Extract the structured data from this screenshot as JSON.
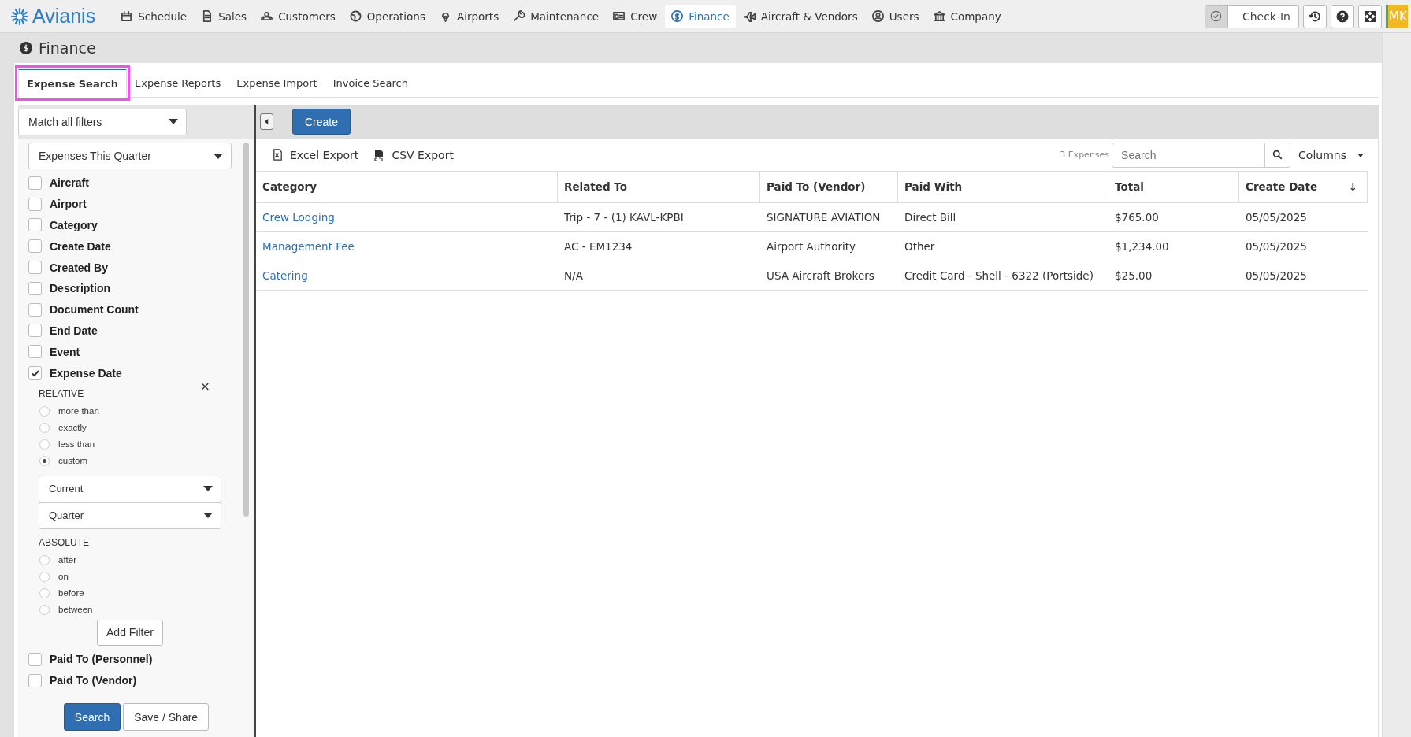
{
  "brand": "Avianis",
  "nav": [
    {
      "label": "Schedule",
      "selected": false
    },
    {
      "label": "Sales",
      "selected": false
    },
    {
      "label": "Customers",
      "selected": false
    },
    {
      "label": "Operations",
      "selected": false
    },
    {
      "label": "Airports",
      "selected": false
    },
    {
      "label": "Maintenance",
      "selected": false
    },
    {
      "label": "Crew",
      "selected": false
    },
    {
      "label": "Finance",
      "selected": true
    },
    {
      "label": "Aircraft & Vendors",
      "selected": false
    },
    {
      "label": "Users",
      "selected": false
    },
    {
      "label": "Company",
      "selected": false
    }
  ],
  "toolbar": {
    "checkin": "Check-In",
    "avatar": "MK"
  },
  "page_title": "Finance",
  "tabs": [
    {
      "label": "Expense Search",
      "selected": true
    },
    {
      "label": "Expense Reports",
      "selected": false
    },
    {
      "label": "Expense Import",
      "selected": false
    },
    {
      "label": "Invoice Search",
      "selected": false
    }
  ],
  "filter_panel": {
    "match": "Match all filters",
    "preset": "Expenses This Quarter",
    "filters": [
      {
        "label": "Aircraft",
        "checked": false
      },
      {
        "label": "Airport",
        "checked": false
      },
      {
        "label": "Category",
        "checked": false
      },
      {
        "label": "Create Date",
        "checked": false
      },
      {
        "label": "Created By",
        "checked": false
      },
      {
        "label": "Description",
        "checked": false
      },
      {
        "label": "Document Count",
        "checked": false
      },
      {
        "label": "End Date",
        "checked": false
      },
      {
        "label": "Event",
        "checked": false
      },
      {
        "label": "Expense Date",
        "checked": true
      }
    ],
    "editor": {
      "close": "×",
      "relative_heading": "RELATIVE",
      "relative": [
        {
          "label": "more than",
          "selected": false
        },
        {
          "label": "exactly",
          "selected": false
        },
        {
          "label": "less than",
          "selected": false
        },
        {
          "label": "custom",
          "selected": true
        }
      ],
      "selects": [
        "Current",
        "Quarter"
      ],
      "absolute_heading": "ABSOLUTE",
      "absolute": [
        {
          "label": "after",
          "selected": false
        },
        {
          "label": "on",
          "selected": false
        },
        {
          "label": "before",
          "selected": false
        },
        {
          "label": "between",
          "selected": false
        }
      ],
      "add": "Add Filter"
    },
    "more_filters": [
      {
        "label": "Paid To (Personnel)",
        "checked": false
      },
      {
        "label": "Paid To (Vendor)",
        "checked": false
      }
    ],
    "buttons": [
      "Search",
      "Save / Share"
    ]
  },
  "main": {
    "create": "Create",
    "exports": [
      "Excel Export",
      "CSV Export"
    ],
    "count": "3 Expenses",
    "search": {
      "placeholder": "Search"
    },
    "columns_button": "Columns",
    "table": {
      "columns": [
        {
          "label": "Category",
          "sorted": false
        },
        {
          "label": "Related To",
          "sorted": false
        },
        {
          "label": "Paid To (Vendor)",
          "sorted": false
        },
        {
          "label": "Paid With",
          "sorted": false
        },
        {
          "label": "Total",
          "sorted": false
        },
        {
          "label": "Create Date",
          "sorted": true
        }
      ],
      "sort_mark": "↓",
      "rows": [
        [
          "Crew Lodging",
          "Trip - 7 - (1) KAVL-KPBI",
          "SIGNATURE AVIATION",
          "Direct Bill",
          "$765.00",
          "05/05/2025"
        ],
        [
          "Management Fee",
          "AC - EM1234",
          "Airport Authority",
          "Other",
          "$1,234.00",
          "05/05/2025"
        ],
        [
          "Catering",
          "N/A",
          "USA Aircraft Brokers",
          "Credit Card - Shell - 6322 (Portside)",
          "$25.00",
          "05/05/2025"
        ]
      ]
    }
  }
}
